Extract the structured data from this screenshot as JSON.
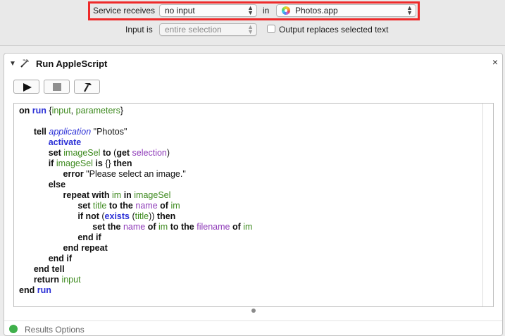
{
  "service_bar": {
    "receives_label": "Service receives",
    "receives_value": "no input",
    "in_label": "in",
    "app_value": "Photos.app",
    "input_is_label": "Input is",
    "input_is_value": "entire selection",
    "output_replaces_label": "Output replaces selected text",
    "output_replaces_checked": false,
    "highlight_color": "#ee2a2a"
  },
  "action": {
    "title": "Run AppleScript",
    "icon": "applescript-icon",
    "close_symbol": "×",
    "toolbar": [
      "run-icon",
      "stop-icon",
      "compile-hammer-icon"
    ],
    "results_label": "Results    Options"
  },
  "script": {
    "lines": [
      "on run {input, parameters}",
      "",
      "tell application \"Photos\"",
      "activate",
      "set imageSel to (get selection)",
      "if imageSel is {} then",
      "error \"Please select an image.\"",
      "else",
      "repeat with im in imageSel",
      "set title to the name of im",
      "if not (exists (title)) then",
      "set the name of im to the filename of im",
      "end if",
      "end repeat",
      "end if",
      "end tell",
      "return input",
      "end run"
    ]
  },
  "colors": {
    "keyword": "#111111",
    "keyword_blue": "#2b30d6",
    "variable": "#3e8a1f",
    "property": "#8e3ab8"
  }
}
